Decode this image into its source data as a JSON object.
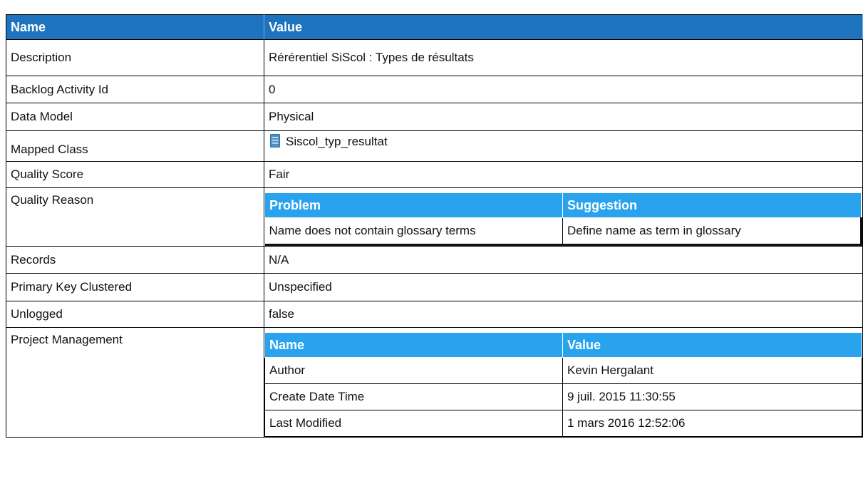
{
  "page": {
    "clipped_title": ""
  },
  "table": {
    "headers": {
      "name": "Name",
      "value": "Value"
    },
    "rows": {
      "description": {
        "label": "Description",
        "value": "Rérérentiel SiScol : Types de résultats"
      },
      "backlog": {
        "label": "Backlog Activity Id",
        "value": "0"
      },
      "data_model": {
        "label": "Data Model",
        "value": "Physical"
      },
      "mapped_class": {
        "label": "Mapped Class",
        "value": "Siscol_typ_resultat",
        "icon": "class-icon"
      },
      "quality_score": {
        "label": "Quality Score",
        "value": "Fair"
      },
      "quality_reason": {
        "label": "Quality Reason",
        "headers": {
          "problem": "Problem",
          "suggestion": "Suggestion"
        },
        "rows": [
          {
            "problem": "Name does not contain glossary terms",
            "suggestion": "Define name as term in glossary"
          }
        ]
      },
      "records": {
        "label": "Records",
        "value": "N/A"
      },
      "pk_clustered": {
        "label": "Primary Key Clustered",
        "value": "Unspecified"
      },
      "unlogged": {
        "label": "Unlogged",
        "value": "false"
      },
      "project_management": {
        "label": "Project Management",
        "headers": {
          "name": "Name",
          "value": "Value"
        },
        "rows": [
          {
            "name": "Author",
            "value": "Kevin Hergalant"
          },
          {
            "name": "Create Date Time",
            "value": "9 juil. 2015 11:30:55"
          },
          {
            "name": "Last Modified",
            "value": "1 mars 2016 12:52:06"
          }
        ]
      }
    }
  },
  "colors": {
    "header_bg": "#1e73be",
    "subheader_bg": "#2aa3ee",
    "icon": "#4a90c8"
  }
}
